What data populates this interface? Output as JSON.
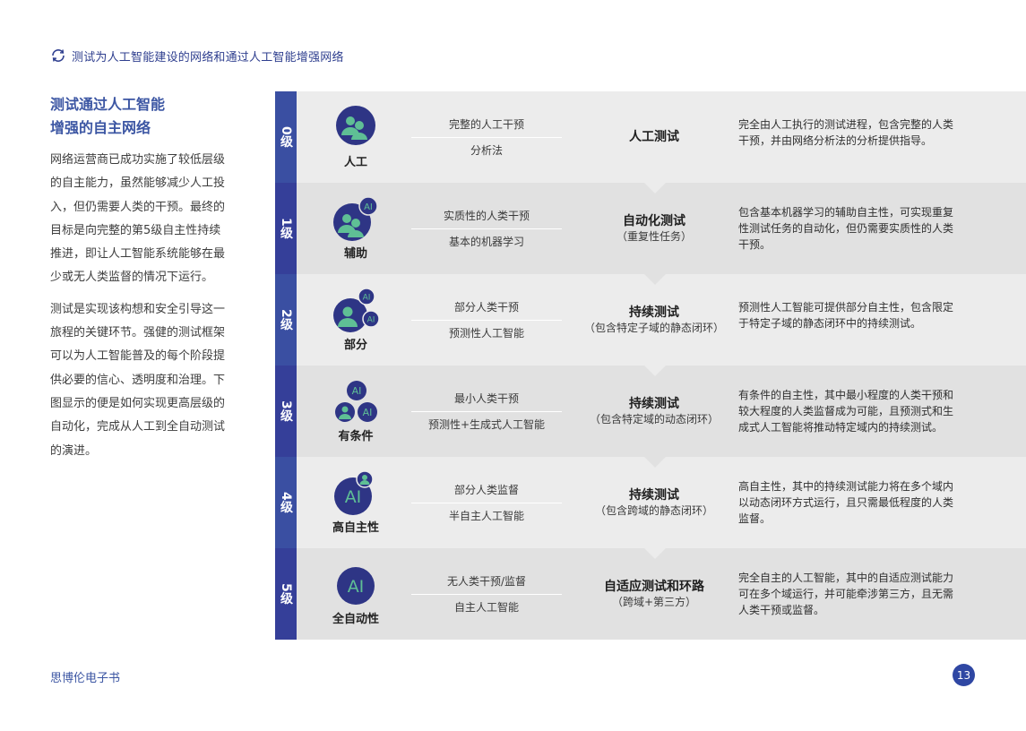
{
  "header": {
    "text": "测试为人工智能建设的网络和通过人工智能增强网络"
  },
  "left": {
    "title_line1": "测试通过人工智能",
    "title_line2": "增强的自主网络",
    "para1": "网络运营商已成功实施了较低层级的自主能力，虽然能够减少人工投入，但仍需要人类的干预。最终的目标是向完整的第5级自主性持续推进，即让人工智能系统能够在最少或无人类监督的情况下运行。",
    "para2": "测试是实现该构想和安全引导这一旅程的关键环节。强健的测试框架可以为人工智能普及的每个阶段提供必要的信心、透明度和治理。下图显示的便是如何实现更高层级的自动化，完成从人工到全自动测试的演进。"
  },
  "colors": {
    "bar0": "#3a4fa2",
    "bar1": "#353f99",
    "bar2": "#3a4fa2",
    "bar3": "#353f99",
    "bar4": "#3a4fa2",
    "bar5": "#353f99",
    "icon_navy": "#2e3585",
    "icon_green": "#5fbf95",
    "accent": "#3c56a3"
  },
  "levels": [
    {
      "level": "0级",
      "name": "人工",
      "icon": "two-people-icon",
      "human": "完整的人工干预",
      "ai": "分析法",
      "mode": "人工测试",
      "mode_sub": "",
      "desc": "完全由人工执行的测试进程，包含完整的人类干预，并由网络分析法的分析提供指导。"
    },
    {
      "level": "1级",
      "name": "辅助",
      "icon": "two-people-one-ai-icon",
      "human": "实质性的人类干预",
      "ai": "基本的机器学习",
      "mode": "自动化测试",
      "mode_sub": "（重复性任务）",
      "desc": "包含基本机器学习的辅助自主性，可实现重复性测试任务的自动化，但仍需要实质性的人类干预。"
    },
    {
      "level": "2级",
      "name": "部分",
      "icon": "person-two-ai-icon",
      "human": "部分人类干预",
      "ai": "预测性人工智能",
      "mode": "持续测试",
      "mode_sub": "（包含特定子域的静态闭环）",
      "desc": "预测性人工智能可提供部分自主性，包含限定于特定子域的静态闭环中的持续测试。"
    },
    {
      "level": "3级",
      "name": "有条件",
      "icon": "small-person-two-ai-icon",
      "human": "最小人类干预",
      "ai": "预测性+生成式人工智能",
      "mode": "持续测试",
      "mode_sub": "（包含特定域的动态闭环）",
      "desc": "有条件的自主性，其中最小程度的人类干预和较大程度的人类监督成为可能，且预测式和生成式人工智能将推动特定域内的持续测试。"
    },
    {
      "level": "4级",
      "name": "高自主性",
      "icon": "ai-with-person-icon",
      "human": "部分人类监督",
      "ai": "半自主人工智能",
      "mode": "持续测试",
      "mode_sub": "（包含跨域的静态闭环）",
      "desc": "高自主性，其中的持续测试能力将在多个域内以动态闭环方式运行，且只需最低程度的人类监督。"
    },
    {
      "level": "5级",
      "name": "全自动性",
      "icon": "ai-icon",
      "human": "无人类干预/监督",
      "ai": "自主人工智能",
      "mode": "自适应测试和环路",
      "mode_sub": "（跨域+第三方）",
      "desc": "完全自主的人工智能，其中的自适应测试能力可在多个域运行，并可能牵涉第三方，且无需人类干预或监督。"
    }
  ],
  "footer": {
    "text": "思博伦电子书",
    "page": "13"
  }
}
